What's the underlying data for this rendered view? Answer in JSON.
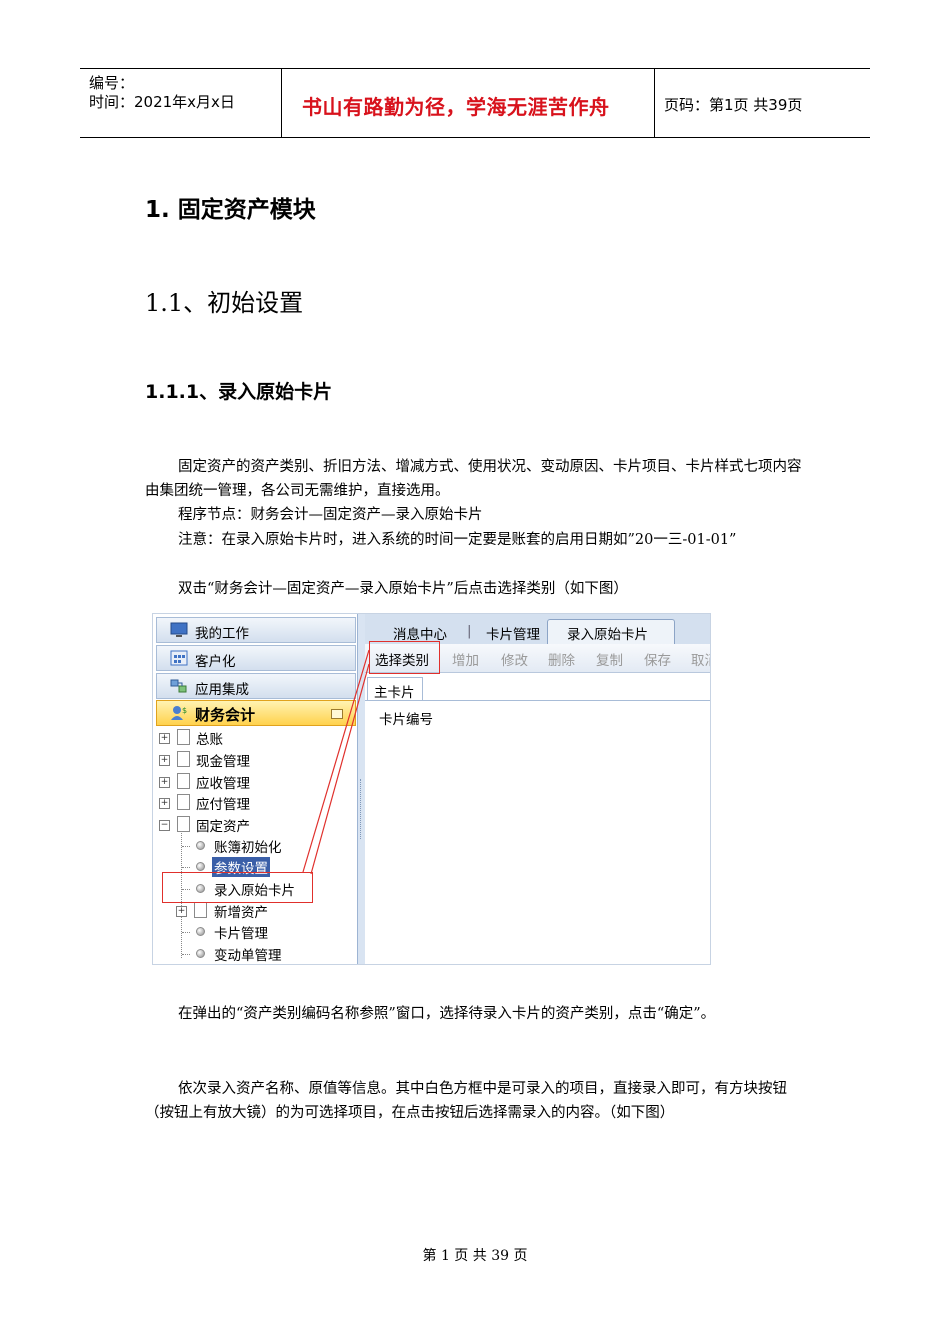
{
  "header": {
    "code_label": "编号：",
    "time_label": "时间：2021年x月x日",
    "motto": "书山有路勤为径，学海无涯苦作舟",
    "page_info": "页码：第1页  共39页"
  },
  "doc": {
    "h1": "1. 固定资产模块",
    "h2": "1.1、初始设置",
    "h3": "1.1.1、录入原始卡片",
    "para1": "固定资产的资产类别、折旧方法、增减方式、使用状况、变动原因、卡片项目、卡片样式七项内容由集团统一管理，各公司无需维护，直接选用。",
    "para2": "程序节点：财务会计—固定资产—录入原始卡片",
    "para3": "注意：在录入原始卡片时，进入系统的时间一定要是账套的启用日期如”20一三-01-01”",
    "para4": "双击“财务会计—固定资产—录入原始卡片”后点击选择类别（如下图）",
    "para5": "在弹出的“资产类别编码名称参照”窗口，选择待录入卡片的资产类别，点击“确定”。",
    "para6": "依次录入资产名称、原值等信息。其中白色方框中是可录入的项目，直接录入即可，有方块按钮（按钮上有放大镜）的为可选择项目，在点击按钮后选择需录入的内容。（如下图）"
  },
  "screenshot": {
    "nav": {
      "my_work": "我的工作",
      "customize": "客户化",
      "app_integration": "应用集成",
      "finance": "财务会计"
    },
    "tree": {
      "general_ledger": "总账",
      "cash_mgmt": "现金管理",
      "receivable": "应收管理",
      "payable": "应付管理",
      "fixed_assets": "固定资产",
      "ledger_init": "账簿初始化",
      "param_settings": "参数设置",
      "enter_card": "录入原始卡片",
      "new_assets": "新增资产",
      "card_mgmt": "卡片管理",
      "change_mgmt": "变动单管理"
    },
    "tabs": {
      "message_center": "消息中心",
      "separator": "|",
      "card_mgmt": "卡片管理",
      "enter_card": "录入原始卡片"
    },
    "toolbar": {
      "select_category": "选择类别",
      "add": "增加",
      "modify": "修改",
      "delete": "删除",
      "copy": "复制",
      "save": "保存",
      "cancel": "取消"
    },
    "subtab": "主卡片",
    "field_card_no": "卡片编号"
  },
  "footer": "第 1 页 共 39 页"
}
